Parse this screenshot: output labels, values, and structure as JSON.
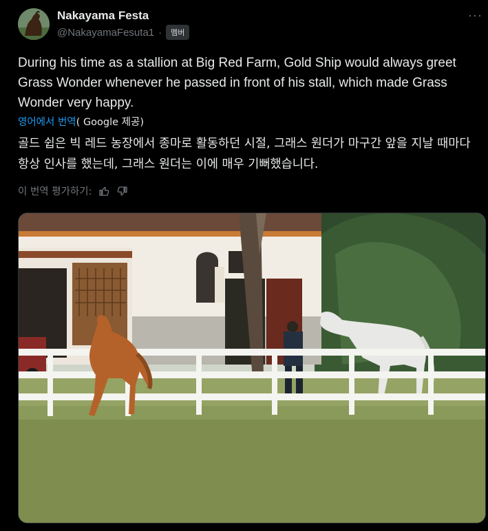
{
  "author": {
    "display_name": "Nakayama Festa",
    "handle": "@NakayamaFesuta1",
    "separator": "·",
    "badge": "멤버"
  },
  "menu": {
    "more_glyph": "···"
  },
  "tweet": {
    "text": "During his time as a stallion at Big Red Farm, Gold Ship would always greet Grass Wonder whenever he passed in front of his stall, which made Grass Wonder very happy."
  },
  "translation": {
    "link_label": "영어에서 번역",
    "provider_open": "( ",
    "provider_name": "Google",
    "provider_suffix": " 제공)",
    "text": "골드 쉽은 빅 레드 농장에서 종마로 활동하던 시절, 그래스 원더가 마구간 앞을 지날 때마다 항상 인사를 했는데, 그래스 원더는 이에 매우 기뻐했습니다."
  },
  "rating": {
    "label": "이 번역 평가하기:",
    "thumbs_up_icon": "thumbs-up-icon",
    "thumbs_down_icon": "thumbs-down-icon"
  },
  "colors": {
    "background": "#000000",
    "text": "#e7e9ea",
    "muted": "#71767b",
    "link": "#1d9bf0"
  }
}
